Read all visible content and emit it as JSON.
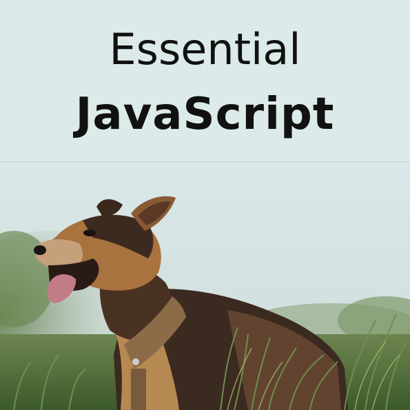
{
  "cover": {
    "title_line1": "Essential",
    "title_line2": "JavaScript"
  },
  "colors": {
    "title_band": "#dcebea",
    "title_text": "#111111",
    "sky": "#d8e6e6",
    "foliage": "#5f7a45",
    "dog_tan": "#b07a45",
    "dog_dark": "#3a2a1f"
  },
  "photo": {
    "subject": "dog-in-tall-grass"
  }
}
